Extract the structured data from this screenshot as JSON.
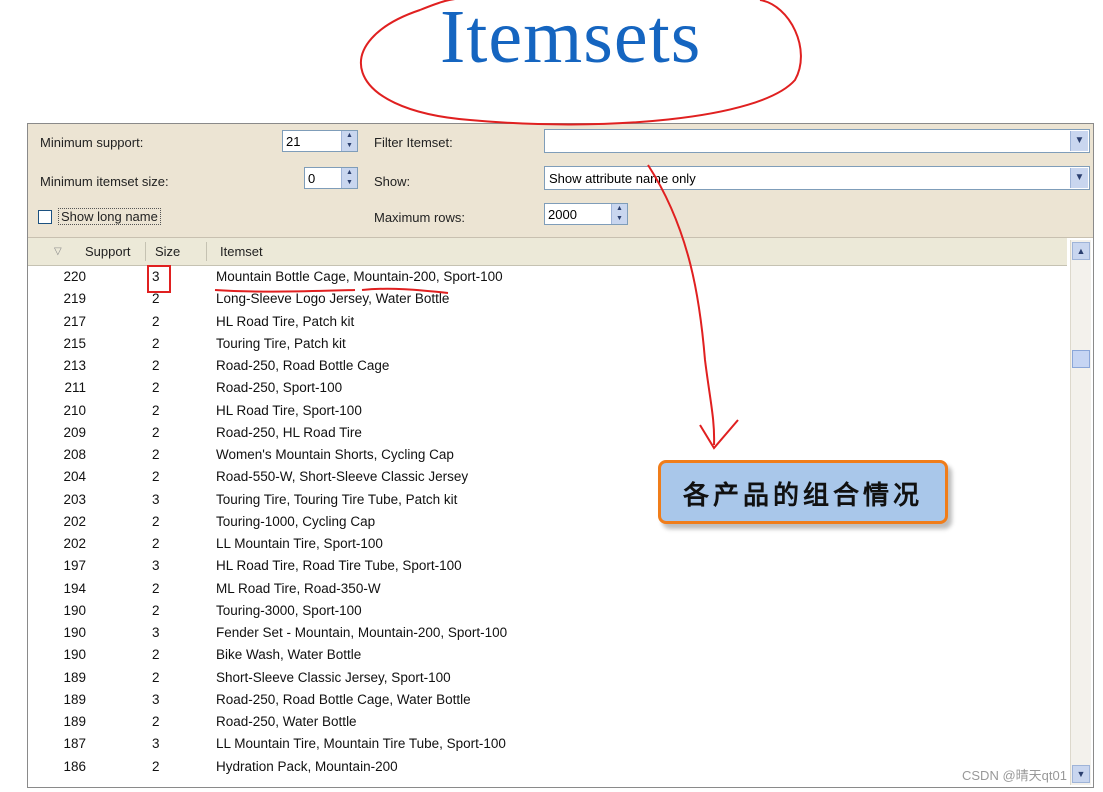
{
  "heading": "Itemsets",
  "filters": {
    "min_support_label": "Minimum support:",
    "min_support_value": "21",
    "min_size_label": "Minimum itemset size:",
    "min_size_value": "0",
    "show_long_name_label": "Show long name",
    "filter_label": "Filter Itemset:",
    "filter_value": "",
    "show_label": "Show:",
    "show_value": "Show attribute name only",
    "max_rows_label": "Maximum rows:",
    "max_rows_value": "2000"
  },
  "table": {
    "columns": [
      "Support",
      "Size",
      "Itemset"
    ],
    "rows": [
      {
        "support": "220",
        "size": "3",
        "itemset": "Mountain Bottle Cage, Mountain-200, Sport-100"
      },
      {
        "support": "219",
        "size": "2",
        "itemset": "Long-Sleeve Logo Jersey, Water Bottle"
      },
      {
        "support": "217",
        "size": "2",
        "itemset": "HL Road Tire, Patch kit"
      },
      {
        "support": "215",
        "size": "2",
        "itemset": "Touring Tire, Patch kit"
      },
      {
        "support": "213",
        "size": "2",
        "itemset": "Road-250, Road Bottle Cage"
      },
      {
        "support": "211",
        "size": "2",
        "itemset": "Road-250, Sport-100"
      },
      {
        "support": "210",
        "size": "2",
        "itemset": "HL Road Tire, Sport-100"
      },
      {
        "support": "209",
        "size": "2",
        "itemset": "Road-250, HL Road Tire"
      },
      {
        "support": "208",
        "size": "2",
        "itemset": "Women's Mountain Shorts, Cycling Cap"
      },
      {
        "support": "204",
        "size": "2",
        "itemset": "Road-550-W, Short-Sleeve Classic Jersey"
      },
      {
        "support": "203",
        "size": "3",
        "itemset": "Touring Tire, Touring Tire Tube, Patch kit"
      },
      {
        "support": "202",
        "size": "2",
        "itemset": "Touring-1000, Cycling Cap"
      },
      {
        "support": "202",
        "size": "2",
        "itemset": "LL Mountain Tire, Sport-100"
      },
      {
        "support": "197",
        "size": "3",
        "itemset": "HL Road Tire, Road Tire Tube, Sport-100"
      },
      {
        "support": "194",
        "size": "2",
        "itemset": "ML Road Tire, Road-350-W"
      },
      {
        "support": "190",
        "size": "2",
        "itemset": "Touring-3000, Sport-100"
      },
      {
        "support": "190",
        "size": "3",
        "itemset": "Fender Set - Mountain, Mountain-200, Sport-100"
      },
      {
        "support": "190",
        "size": "2",
        "itemset": "Bike Wash, Water Bottle"
      },
      {
        "support": "189",
        "size": "2",
        "itemset": "Short-Sleeve Classic Jersey, Sport-100"
      },
      {
        "support": "189",
        "size": "3",
        "itemset": "Road-250, Road Bottle Cage, Water Bottle"
      },
      {
        "support": "189",
        "size": "2",
        "itemset": "Road-250, Water Bottle"
      },
      {
        "support": "187",
        "size": "3",
        "itemset": "LL Mountain Tire, Mountain Tire Tube, Sport-100"
      },
      {
        "support": "186",
        "size": "2",
        "itemset": "Hydration Pack, Mountain-200"
      }
    ]
  },
  "annotation": "各产品的组合情况",
  "watermark": "CSDN @晴天qt01",
  "colors": {
    "accent_red": "#e02020",
    "callout_border": "#f07d1a",
    "callout_fill": "#a9c7ea",
    "title_blue": "#1565c0"
  },
  "icons": {
    "spin_up": "up-arrow-icon",
    "spin_down": "down-arrow-icon",
    "dropdown": "chevron-down-icon",
    "sort": "sort-desc-icon"
  }
}
